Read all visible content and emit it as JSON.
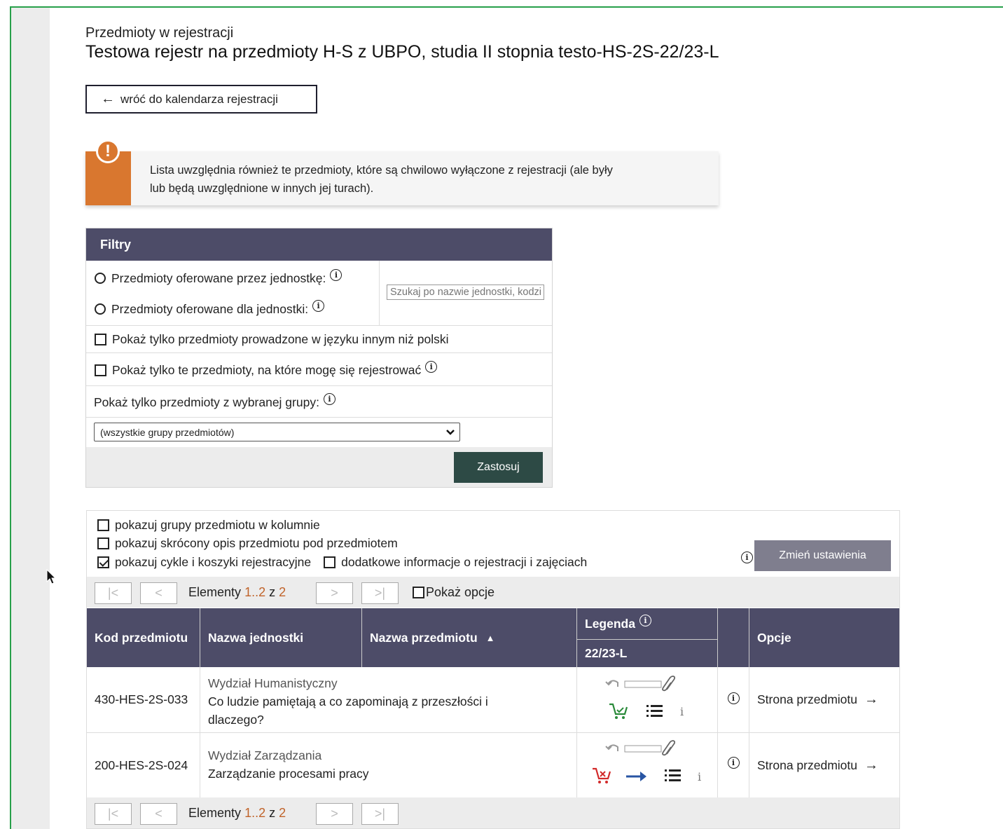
{
  "header": {
    "subtitle": "Przedmioty w rejestracji",
    "title": "Testowa rejestr na przedmioty H-S z UBPO, studia II stopnia testo-HS-2S-22/23-L",
    "back_label": "wróć do kalendarza rejestracji"
  },
  "notice": {
    "line1": "Lista uwzględnia również te przedmioty, które są chwilowo wyłączone z rejestracji (ale były",
    "line2": "lub będą uwzględnione w innych jej turach)."
  },
  "filters": {
    "title": "Filtry",
    "radio_offered_by": "Przedmioty oferowane przez jednostkę:",
    "radio_offered_for": "Przedmioty oferowane dla jednostki:",
    "search_placeholder": "Szukaj po nazwie jednostki, kodzie...",
    "chk_foreign_lang": "Pokaż tylko przedmioty prowadzone w języku innym niż polski",
    "chk_can_register": "Pokaż tylko te przedmioty, na które mogę się rejestrować",
    "group_label": "Pokaż tylko przedmioty z wybranej grupy:",
    "group_selected": "(wszystkie grupy przedmiotów)",
    "apply_label": "Zastosuj"
  },
  "display_options": {
    "opt_groups": "pokazuj grupy przedmiotu w kolumnie",
    "opt_short_desc": "pokazuj skrócony opis przedmiotu pod przedmiotem",
    "opt_cycles": "pokazuj cykle i koszyki rejestracyjne",
    "opt_cycles_checked": true,
    "opt_extra_info": "dodatkowe informacje o rejestracji i zajęciach",
    "change_settings_label": "Zmień ustawienia"
  },
  "pager": {
    "first": "|<",
    "prev": "<",
    "next": ">",
    "last": ">|",
    "elements_label": "Elementy",
    "range": "1..2",
    "of": "z",
    "total": "2",
    "show_options": "Pokaż opcje"
  },
  "table": {
    "col_code": "Kod przedmiotu",
    "col_unit": "Nazwa jednostki",
    "col_name": "Nazwa przedmiotu",
    "sort_indicator": "▲",
    "col_legend": "Legenda",
    "col_cycle": "22/23-L",
    "col_options": "Opcje",
    "rows": [
      {
        "code": "430-HES-2S-033",
        "unit": "Wydział Humanistyczny",
        "name": "Co ludzie pamiętają a co zapominają z przeszłości i dlaczego?",
        "cart_color": "#2a8a3a",
        "link": "Strona przedmiotu"
      },
      {
        "code": "200-HES-2S-024",
        "unit": "Wydział Zarządzania",
        "name": "Zarządzanie procesami pracy",
        "cart_color": "#d22a2a",
        "link": "Strona przedmiotu"
      }
    ]
  },
  "colors": {
    "header_bg": "#4d4c68",
    "accent_orange": "#d9772f",
    "apply_bg": "#2d4a45",
    "frame_green": "#27a04a"
  }
}
